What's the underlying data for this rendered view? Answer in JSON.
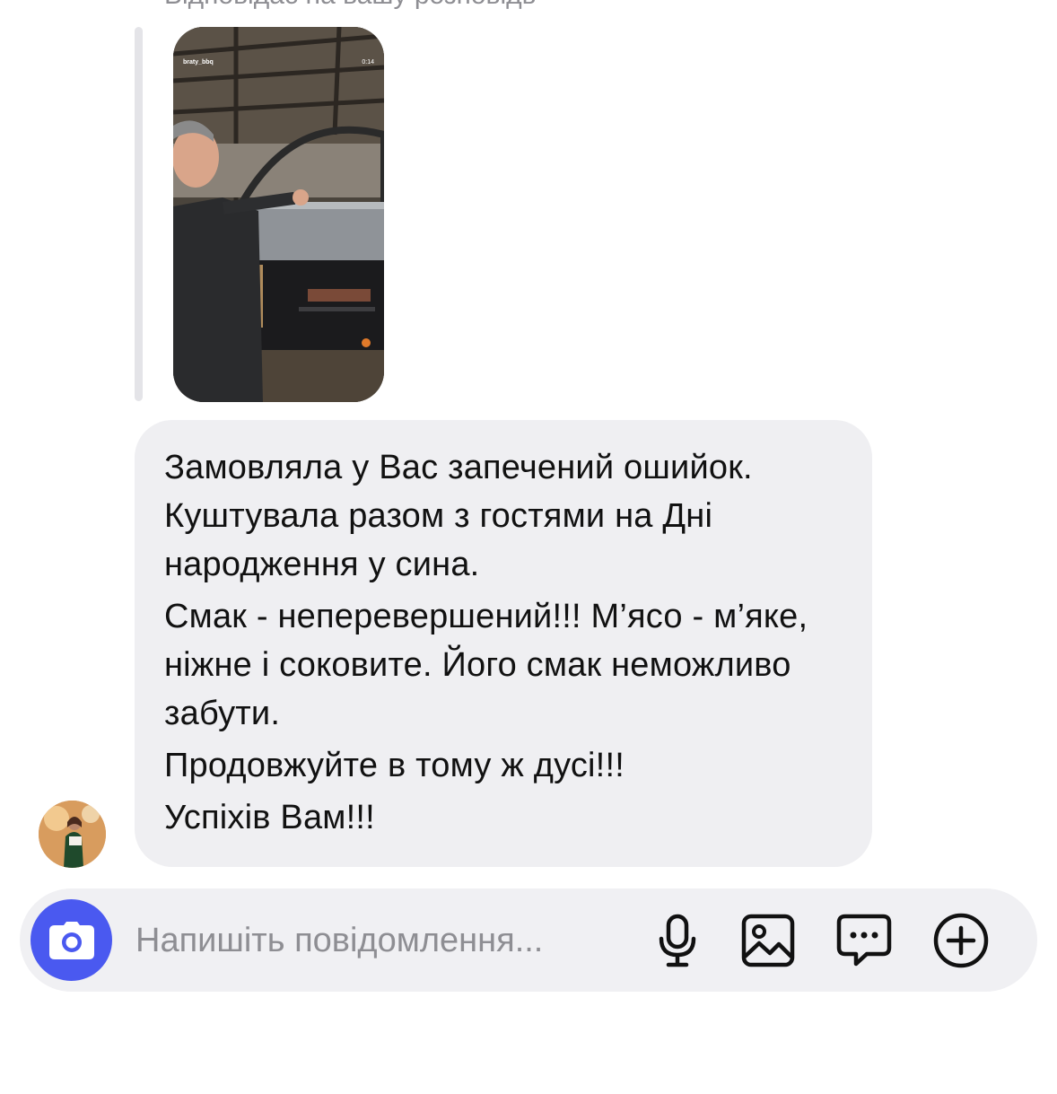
{
  "reply_context": {
    "header_text": "Відповідає на вашу розповідь",
    "story": {
      "username": "braty_bbq",
      "duration": "0:14"
    }
  },
  "message": {
    "paragraphs": [
      "Замовляла у Вас запечений ошийок. Куштувала разом з гостями на Дні народження у сина.",
      "Смак - неперевершений!!! М’ясо - м’яке, ніжне і соковите. Його смак неможливо забути.",
      "Продовжуйте в тому ж дусі!!!",
      "Успіхів Вам!!!"
    ]
  },
  "composer": {
    "placeholder": "Напишіть повідомлення...",
    "icons": [
      "camera-icon",
      "microphone-icon",
      "gallery-icon",
      "sticker-icon",
      "plus-icon"
    ]
  },
  "colors": {
    "accent": "#4a59f0",
    "bubble": "#efeff2",
    "composer_bg": "#f0f0f3",
    "muted_text": "#8e8e93"
  }
}
